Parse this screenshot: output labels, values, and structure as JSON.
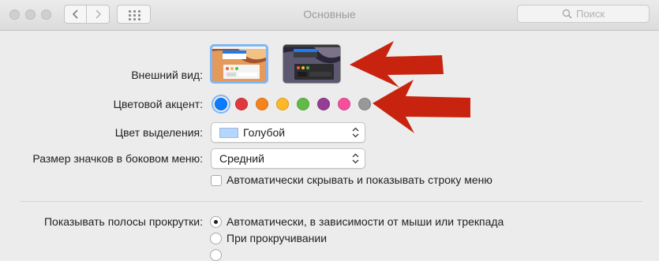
{
  "window": {
    "title": "Основные",
    "search_placeholder": "Поиск"
  },
  "appearance": {
    "label": "Внешний вид:",
    "options": [
      "light",
      "dark"
    ],
    "selected": "light"
  },
  "accent": {
    "label": "Цветовой акцент:",
    "colors": [
      "#0a7cff",
      "#e0383e",
      "#f7821b",
      "#fcb827",
      "#62ba46",
      "#953d96",
      "#f74f9e",
      "#989898"
    ],
    "selected_index": 0
  },
  "highlight": {
    "label": "Цвет выделения:",
    "value": "Голубой",
    "swatch_color": "#b3d7ff"
  },
  "sidebar_icons": {
    "label": "Размер значков в боковом меню:",
    "value": "Средний"
  },
  "menu_bar_autohide": {
    "label": "Автоматически скрывать и показывать строку меню",
    "checked": false
  },
  "scrollbars": {
    "label": "Показывать полосы прокрутки:",
    "options": [
      {
        "label": "Автоматически, в зависимости от мыши или трекпада",
        "selected": true
      },
      {
        "label": "При прокручивании",
        "selected": false
      }
    ]
  },
  "annotations": {
    "arrow_color": "#c8230f"
  }
}
